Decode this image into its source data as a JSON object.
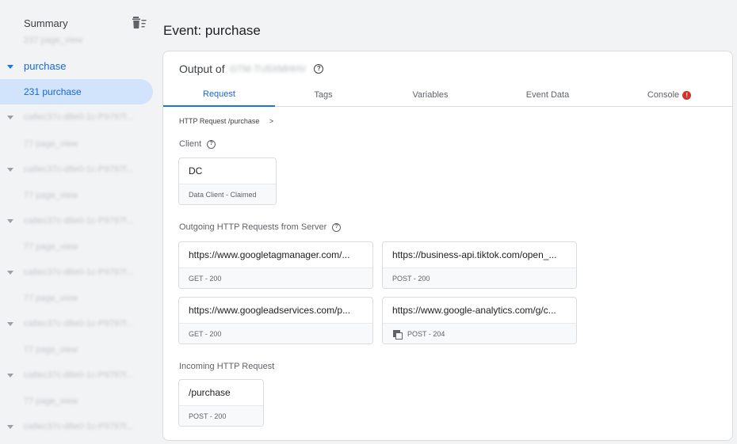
{
  "sidebar": {
    "summary_label": "Summary",
    "purchase_label": "purchase",
    "selected_label": "231 purchase",
    "blurred_items": [
      "237 page_view",
      "ca8ec37c-d8e0-1c-P9797f...",
      "77 page_view",
      "ca8ec37c-d8e0-1c-P9797f...",
      "77 page_view",
      "ca8ec37c-d8e0-1c-P9797f...",
      "77 page_view",
      "ca8ec37c-d8e0-1c-P9797f...",
      "77 page_view",
      "ca8ec37c-d8e0-1c-P9797f...",
      "77 page_view",
      "ca8ec37c-d8e0-1c-P9797f...",
      "77 page_view",
      "ca8ec37c-d8e0-1c-P9797f..."
    ]
  },
  "main": {
    "event_title": "Event: purchase",
    "output_label": "Output of",
    "output_target": "GTM-TU5XMHHV",
    "tabs": [
      {
        "label": "Request",
        "active": true
      },
      {
        "label": "Tags",
        "active": false
      },
      {
        "label": "Variables",
        "active": false
      },
      {
        "label": "Event Data",
        "active": false
      },
      {
        "label": "Console",
        "active": false,
        "error": "!"
      }
    ],
    "breadcrumb": "HTTP Request /purchase",
    "breadcrumb_chevron": ">",
    "client_section": "Client",
    "client_card": {
      "title": "DC",
      "subtitle": "Data Client - Claimed"
    },
    "outgoing_section": "Outgoing HTTP Requests from Server",
    "outgoing_cards": [
      {
        "url": "https://www.googletagmanager.com/...",
        "status": "GET - 200"
      },
      {
        "url": "https://business-api.tiktok.com/open_...",
        "status": "POST - 200"
      },
      {
        "url": "https://www.googleadservices.com/p...",
        "status": "GET - 200"
      },
      {
        "url": "https://www.google-analytics.com/g/c...",
        "status": "POST - 204"
      }
    ],
    "incoming_section": "Incoming HTTP Request",
    "incoming_card": {
      "path": "/purchase",
      "status": "POST - 200"
    }
  },
  "colors": {
    "accent": "#1a73e8",
    "selected_bg": "#d2e3fc",
    "error": "#d93025"
  }
}
